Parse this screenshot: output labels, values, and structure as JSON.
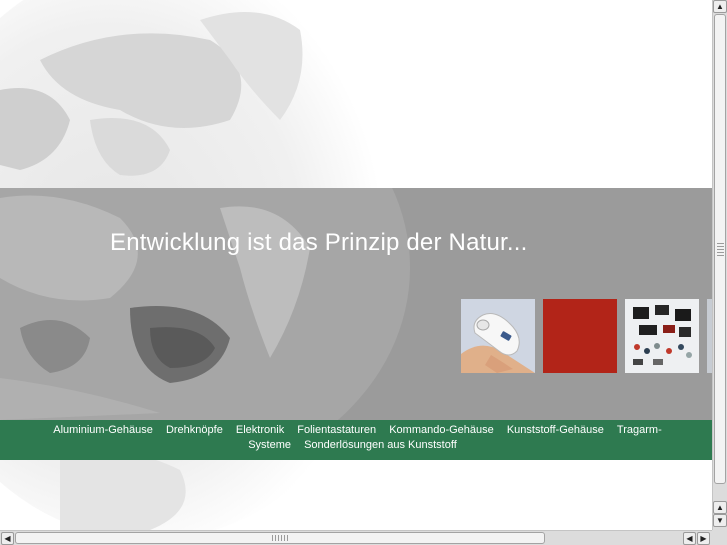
{
  "hero": {
    "headline": "Entwicklung ist das Prinzip der Natur..."
  },
  "thumbnails": [
    {
      "name": "handheld-device-photo"
    },
    {
      "name": "red-panel"
    },
    {
      "name": "electronic-components-photo"
    }
  ],
  "nav": {
    "links": [
      "Aluminium-Gehäuse",
      "Drehknöpfe",
      "Elektronik",
      "Folientastaturen",
      "Kommando-Gehäuse",
      "Kunststoff-Gehäuse",
      "Tragarm-Systeme",
      "Sonderlösungen aus Kunststoff"
    ]
  },
  "colors": {
    "band": "#9b9b9b",
    "nav": "#2e7a50",
    "accent_red": "#b22418"
  },
  "icons": {
    "scroll_up": "arrow-up-icon",
    "scroll_down": "arrow-down-icon",
    "scroll_left": "arrow-left-icon",
    "scroll_right": "arrow-right-icon"
  }
}
